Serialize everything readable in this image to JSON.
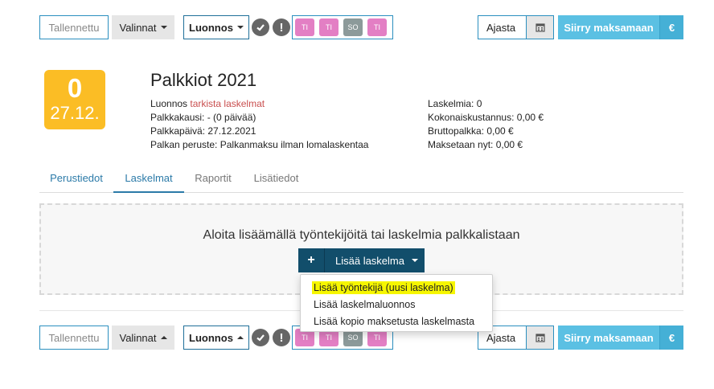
{
  "toolbar": {
    "saved_label": "Tallennettu",
    "options_label": "Valinnat",
    "draft_label": "Luonnos",
    "day_badges": [
      "TI",
      "TI",
      "SO",
      "TI"
    ],
    "schedule_label": "Ajasta",
    "pay_label": "Siirry maksamaan",
    "euro_label": "€",
    "day_colors": {
      "pink": "#e37fc4",
      "gray": "#8c9a9a"
    },
    "icons": [
      "check-circle-icon",
      "warning-circle-icon",
      "calendar-icon",
      "caret-down-icon"
    ]
  },
  "badge": {
    "count": "0",
    "date": "27.12.",
    "color": "#fbbd25"
  },
  "header": {
    "title": "Palkkiot 2021",
    "status_prefix": "Luonnos",
    "status_link": "tarkista laskelmat",
    "period": "Palkkakausi: - (0 päivää)",
    "pay_date": "Palkkapäivä: 27.12.2021",
    "basis": "Palkan peruste: Palkanmaksu ilman lomalaskentaa",
    "calc_count": "Laskelmia: 0",
    "total_cost": "Kokonaiskustannus: 0,00 €",
    "gross": "Bruttopalkka: 0,00 €",
    "paid_now": "Maksetaan nyt: 0,00 €"
  },
  "tabs": [
    "Perustiedot",
    "Laskelmat",
    "Raportit",
    "Lisätiedot"
  ],
  "main": {
    "empty_text": "Aloita lisäämällä työntekijöitä tai laskelmia palkkalistaan",
    "add_plus": "+",
    "add_label": "Lisää laskelma"
  },
  "menu": {
    "items": [
      "Lisää työntekijä (uusi laskelma)",
      "Lisää laskelmaluonnos",
      "Lisää kopio maksetusta laskelmasta"
    ]
  }
}
